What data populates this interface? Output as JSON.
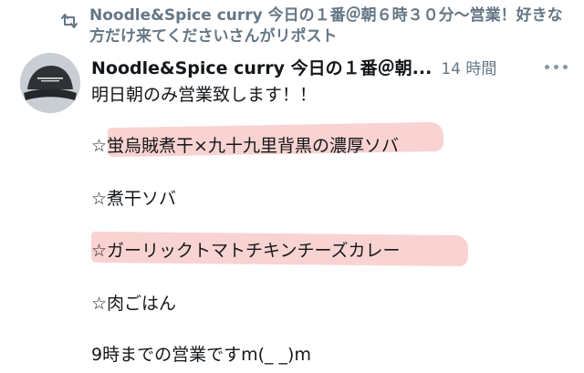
{
  "retweet": {
    "icon": "retweet-icon",
    "line1": "Noodle&Spice curry 今日の１番＠朝６時３０分〜営業！好きな",
    "line2": "方だけ来てくださいさんがリポスト"
  },
  "tweet": {
    "avatar_icon": "avatar",
    "display_name": "Noodle&Spice curry 今日の１番＠朝...",
    "timestamp": "14 時間",
    "more_icon": "more-icon",
    "lines": [
      "明日朝のみ営業致します！！",
      "☆蛍烏賊煮干×九十九里背黒の濃厚ソバ",
      "☆煮干ソバ",
      "☆ガーリックトマトチキンチーズカレー",
      "☆肉ごはん",
      "9時までの営業ですm(_ _)m"
    ]
  },
  "colors": {
    "muted": "#657786",
    "highlight": "#f7c4c1",
    "text": "#14171a"
  }
}
